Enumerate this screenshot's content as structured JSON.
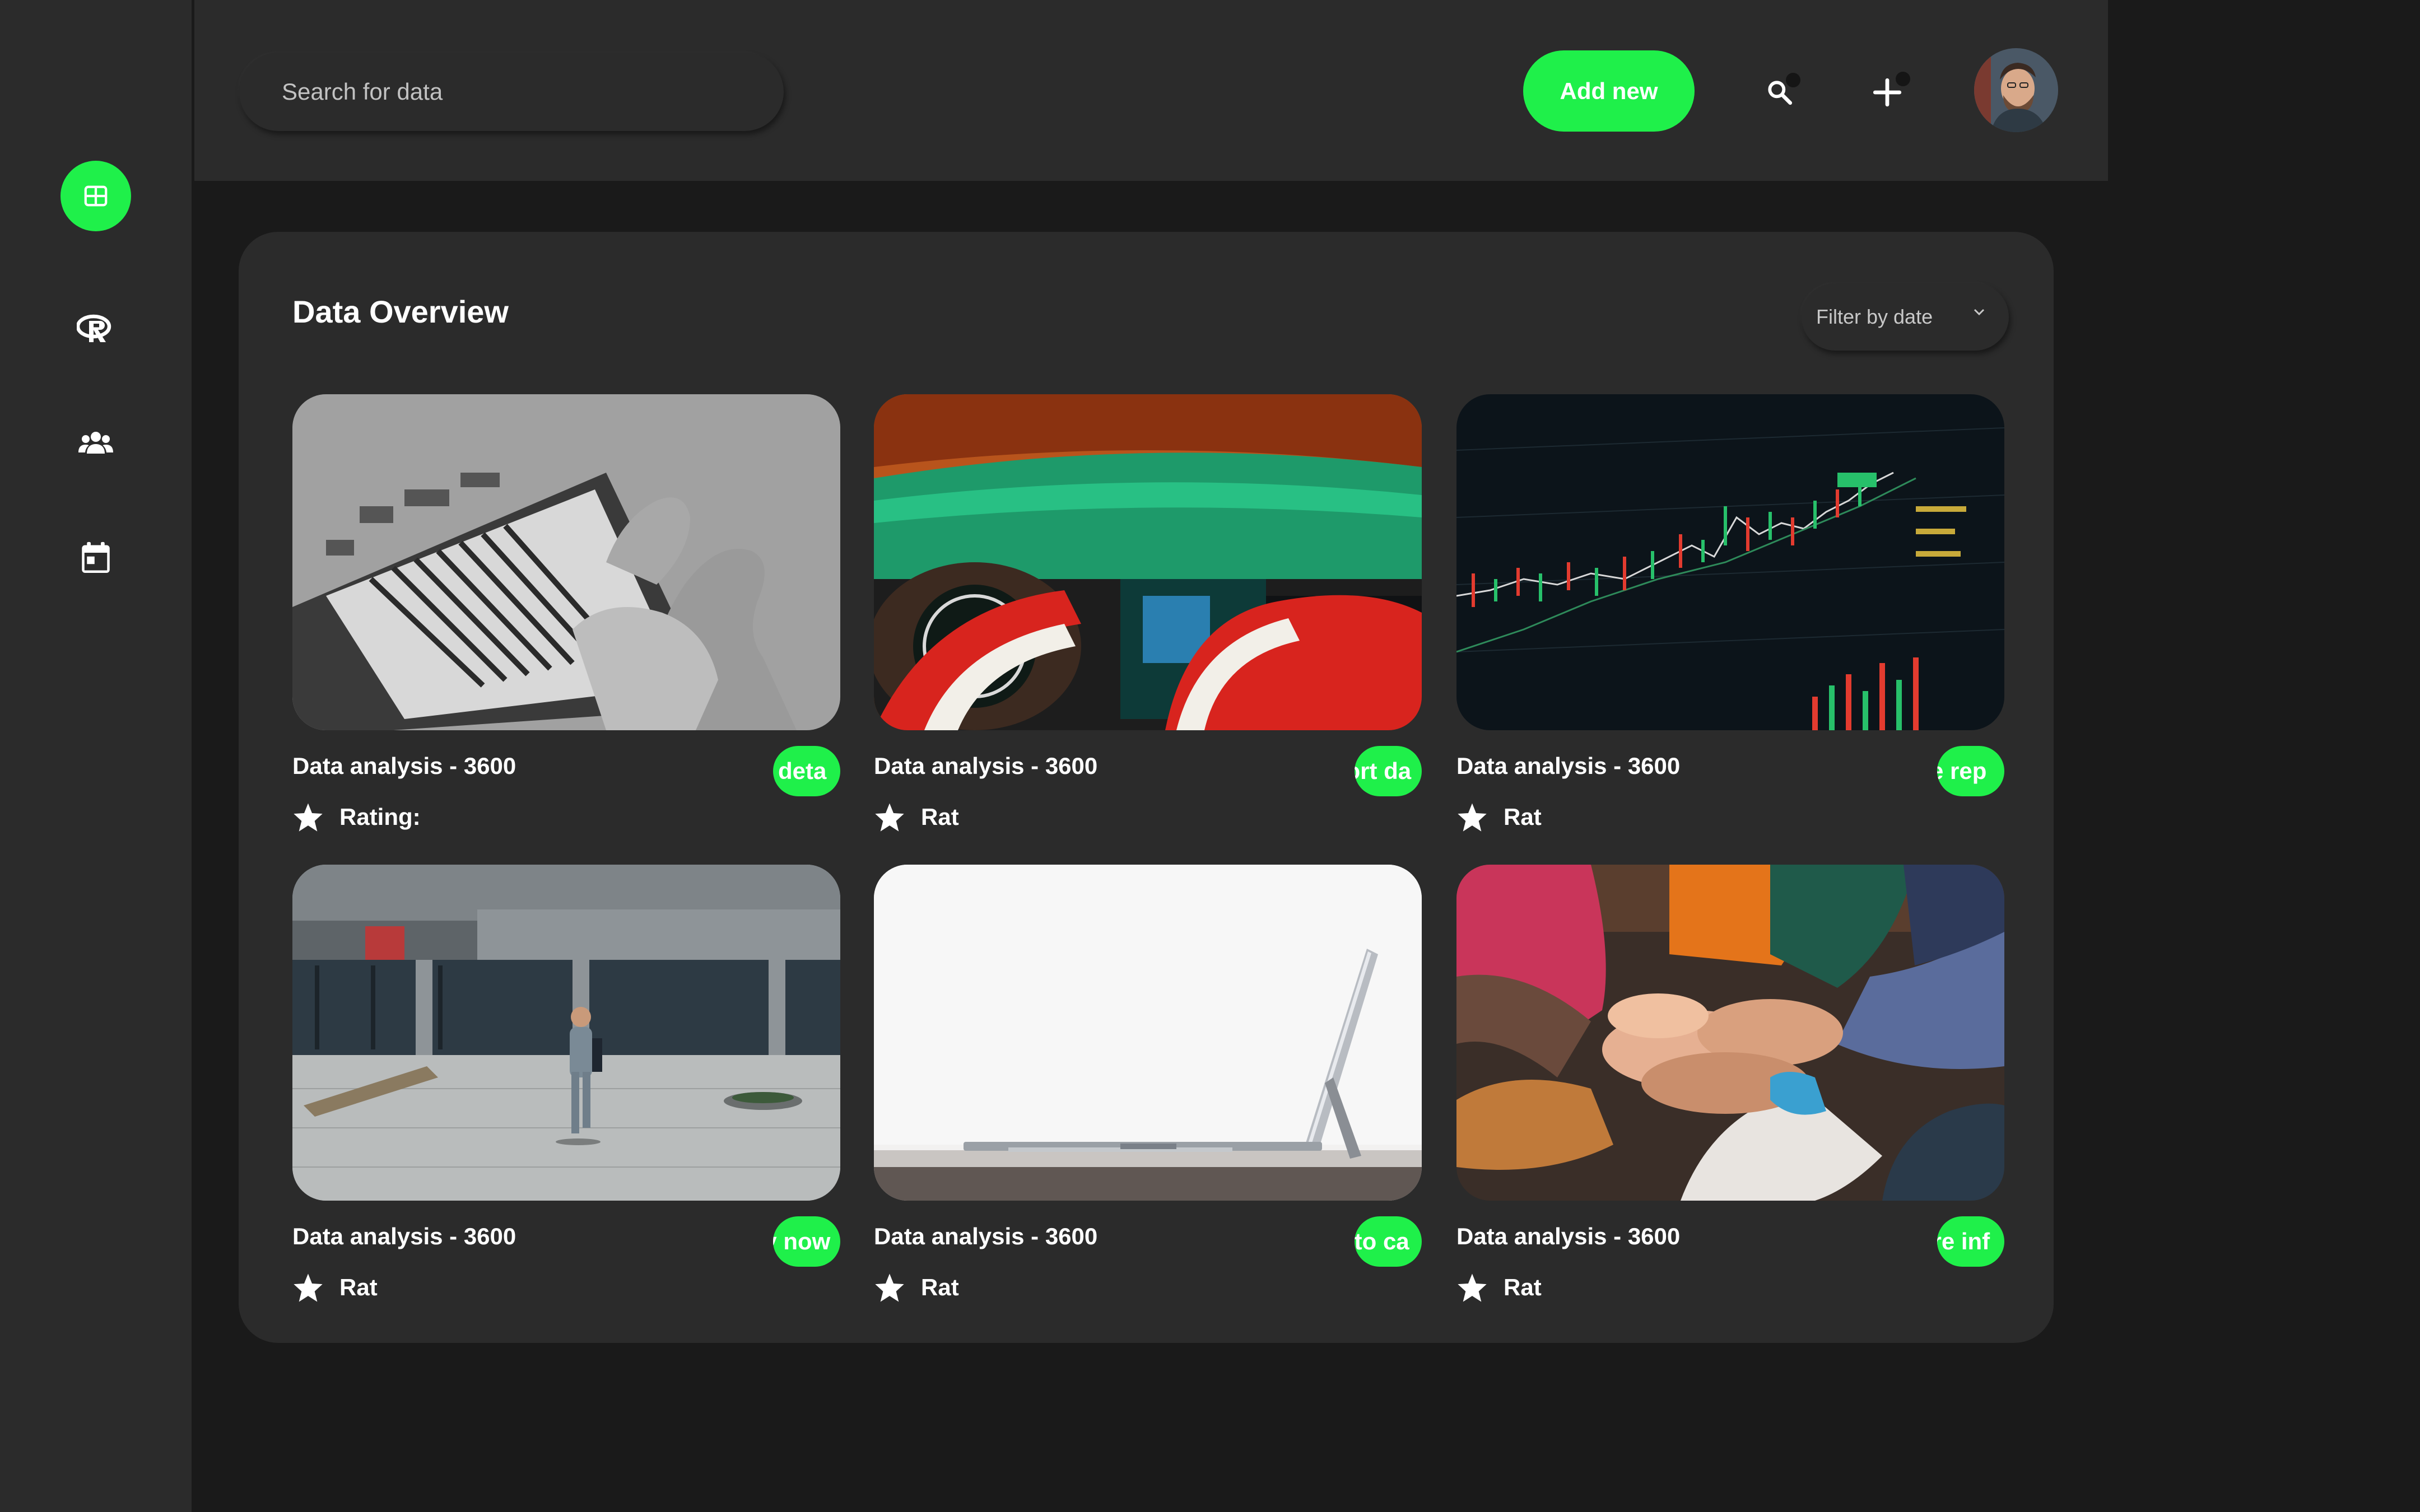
{
  "sidebar": {
    "items": [
      {
        "name": "dashboard",
        "icon": "grid-icon",
        "active": true
      },
      {
        "name": "r-language",
        "icon": "r-logo-icon",
        "active": false
      },
      {
        "name": "users",
        "icon": "users-icon",
        "active": false
      },
      {
        "name": "calendar",
        "icon": "calendar-icon",
        "active": false
      }
    ]
  },
  "header": {
    "search_placeholder": "Search for data",
    "add_new_label": "Add new",
    "search_icon": "search-icon",
    "add_icon": "plus-icon",
    "avatar_icon": "avatar"
  },
  "main": {
    "title": "Data Overview",
    "filter_label": "Filter by date",
    "cards": [
      {
        "title": "Data analysis - 3600",
        "action": "w deta",
        "rating_label": "Rating:"
      },
      {
        "title": "Data analysis - 3600",
        "action": "port da",
        "rating_label": "Rat"
      },
      {
        "title": "Data analysis - 3600",
        "action": "re rep",
        "rating_label": "Rat"
      },
      {
        "title": "Data analysis - 3600",
        "action": "uy now",
        "rating_label": "Rat"
      },
      {
        "title": "Data analysis - 3600",
        "action": "d to ca",
        "rating_label": "Rat"
      },
      {
        "title": "Data analysis - 3600",
        "action": "ore inf",
        "rating_label": "Rat"
      }
    ]
  },
  "colors": {
    "accent": "#1ff04a",
    "background": "#1a1a1a",
    "surface": "#2b2b2b"
  }
}
